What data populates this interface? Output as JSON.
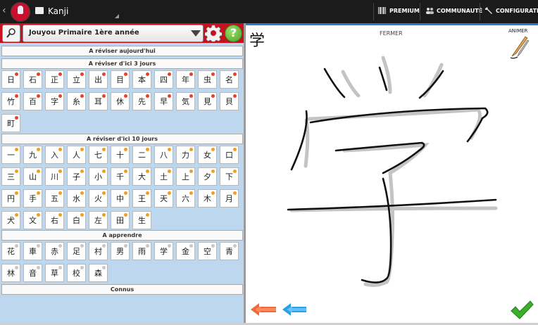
{
  "topbar": {
    "back": "‹",
    "title": "Kanji",
    "premium": "PREMIUM",
    "community": "COMMUNAUTÉ",
    "configuration": "CONFIGURATION"
  },
  "selector": {
    "value": "Jouyou Primaire 1ère année",
    "help": "?"
  },
  "sections": {
    "today": "A réviser aujourd'hui",
    "three_days": "A réviser d'ici 3 jours",
    "ten_days": "A réviser d'ici 10 jours",
    "learn": "A apprendre",
    "known": "Connus"
  },
  "lists": {
    "three_days": [
      "日",
      "石",
      "正",
      "立",
      "出",
      "目",
      "本",
      "四",
      "年",
      "虫",
      "名",
      "竹",
      "百",
      "字",
      "糸",
      "耳",
      "休",
      "先",
      "早",
      "気",
      "見",
      "貝",
      "町"
    ],
    "ten_days": [
      "一",
      "九",
      "入",
      "人",
      "七",
      "十",
      "二",
      "八",
      "力",
      "女",
      "口",
      "三",
      "山",
      "川",
      "子",
      "小",
      "千",
      "大",
      "土",
      "上",
      "夕",
      "下",
      "円",
      "手",
      "五",
      "水",
      "火",
      "中",
      "王",
      "天",
      "六",
      "木",
      "月",
      "犬",
      "文",
      "右",
      "白",
      "左",
      "田",
      "生"
    ],
    "learn": [
      "花",
      "車",
      "赤",
      "足",
      "村",
      "男",
      "雨",
      "学",
      "金",
      "空",
      "青",
      "林",
      "音",
      "草",
      "校",
      "森"
    ]
  },
  "colors": {
    "red": "#c4131f",
    "accent": "#2d78c8",
    "dot_red": "#e8402a",
    "dot_orange": "#f0a020",
    "dot_gray": "#c8c8c8"
  },
  "canvas": {
    "kanji": "学",
    "close": "FERMER",
    "animate": "ANIMER"
  }
}
